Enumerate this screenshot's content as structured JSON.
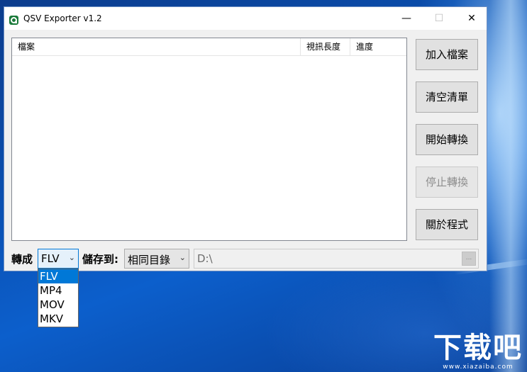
{
  "window": {
    "title": "QSV Exporter v1.2",
    "controls": {
      "minimize": "—",
      "maximize": "☐",
      "close": "✕"
    }
  },
  "file_list": {
    "columns": [
      "檔案",
      "視訊長度",
      "進度"
    ],
    "rows": []
  },
  "side_buttons": {
    "add_files": "加入檔案",
    "clear_list": "清空清單",
    "start_convert": "開始轉換",
    "stop_convert": "停止轉換",
    "about": "關於程式"
  },
  "bottom_bar": {
    "convert_label": "轉成",
    "format_selected": "FLV",
    "save_label": "儲存到:",
    "save_target": "相同目錄",
    "path": "D:\\",
    "browse_label": "..."
  },
  "format_dropdown": {
    "options": [
      "FLV",
      "MP4",
      "MOV",
      "MKV"
    ],
    "highlighted": "FLV"
  },
  "desktop": {
    "watermark_main": "下载吧",
    "watermark_sub": "www.xiazaiba.com"
  },
  "colors": {
    "accent": "#0078d7",
    "window_bg": "#f0f0f0",
    "desktop": "#0a4fb0"
  },
  "icons": [
    "app-logo-icon",
    "minimize-icon",
    "maximize-icon",
    "close-icon",
    "chevron-down-icon"
  ]
}
